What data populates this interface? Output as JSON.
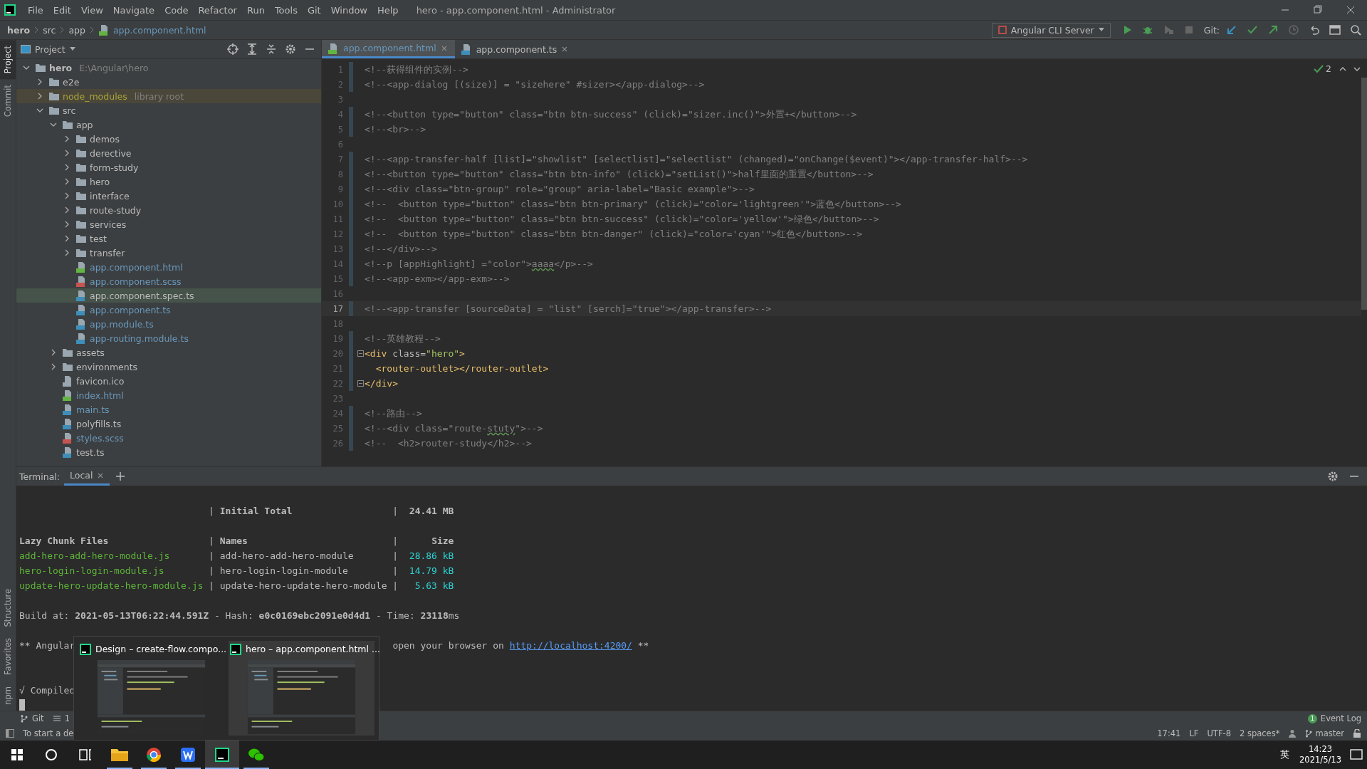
{
  "window": {
    "title": "hero - app.component.html - Administrator"
  },
  "menu": [
    "File",
    "Edit",
    "View",
    "Navigate",
    "Code",
    "Refactor",
    "Run",
    "Tools",
    "Git",
    "Window",
    "Help"
  ],
  "breadcrumbs": [
    "hero",
    "src",
    "app",
    "app.component.html"
  ],
  "toolbar": {
    "run_config": "Angular CLI Server",
    "git_label": "Git:"
  },
  "side_tabs_top": [
    {
      "label": "Project",
      "selected": true
    },
    {
      "label": "Commit",
      "selected": false
    }
  ],
  "side_tabs_bottom": [
    {
      "label": "Structure",
      "selected": false
    },
    {
      "label": "Favorites",
      "selected": false
    },
    {
      "label": "npm",
      "selected": false
    }
  ],
  "project": {
    "title": "Project",
    "tree": [
      {
        "name": "hero",
        "kind": "folder",
        "expanded": true,
        "color": "#bbbbbb",
        "excluded": false,
        "note": "E:\\Angular\\hero",
        "selected": false,
        "children": [
          {
            "name": "e2e",
            "kind": "folder",
            "expanded": false,
            "color": "#bbbbbb",
            "excluded": false,
            "selected": false
          },
          {
            "name": "node_modules",
            "kind": "folder",
            "expanded": false,
            "color": "#a8a23a",
            "excluded": true,
            "note": "library root",
            "selected": false
          },
          {
            "name": "src",
            "kind": "folder",
            "expanded": true,
            "color": "#bbbbbb",
            "excluded": false,
            "selected": false,
            "children": [
              {
                "name": "app",
                "kind": "folder",
                "expanded": true,
                "color": "#bbbbbb",
                "excluded": false,
                "selected": false,
                "children": [
                  {
                    "name": "demos",
                    "kind": "folder",
                    "expanded": false,
                    "color": "#bbbbbb",
                    "excluded": false,
                    "selected": false
                  },
                  {
                    "name": "derective",
                    "kind": "folder",
                    "expanded": false,
                    "color": "#bbbbbb",
                    "excluded": false,
                    "selected": false
                  },
                  {
                    "name": "form-study",
                    "kind": "folder",
                    "expanded": false,
                    "color": "#bbbbbb",
                    "excluded": false,
                    "selected": false
                  },
                  {
                    "name": "hero",
                    "kind": "folder",
                    "expanded": false,
                    "color": "#bbbbbb",
                    "excluded": false,
                    "selected": false
                  },
                  {
                    "name": "interface",
                    "kind": "folder",
                    "expanded": false,
                    "color": "#bbbbbb",
                    "excluded": false,
                    "selected": false
                  },
                  {
                    "name": "route-study",
                    "kind": "folder",
                    "expanded": false,
                    "color": "#bbbbbb",
                    "excluded": false,
                    "selected": false
                  },
                  {
                    "name": "services",
                    "kind": "folder",
                    "expanded": false,
                    "color": "#bbbbbb",
                    "excluded": false,
                    "selected": false
                  },
                  {
                    "name": "test",
                    "kind": "folder",
                    "expanded": false,
                    "color": "#bbbbbb",
                    "excluded": false,
                    "selected": false
                  },
                  {
                    "name": "transfer",
                    "kind": "folder",
                    "expanded": false,
                    "color": "#bbbbbb",
                    "excluded": false,
                    "selected": false
                  },
                  {
                    "name": "app.component.html",
                    "kind": "html",
                    "color": "#6897bb",
                    "excluded": false,
                    "selected": false
                  },
                  {
                    "name": "app.component.scss",
                    "kind": "scss",
                    "color": "#6897bb",
                    "excluded": false,
                    "selected": false
                  },
                  {
                    "name": "app.component.spec.ts",
                    "kind": "ts",
                    "color": "#bbbbbb",
                    "excluded": false,
                    "selected": true
                  },
                  {
                    "name": "app.component.ts",
                    "kind": "ts",
                    "color": "#6897bb",
                    "excluded": false,
                    "selected": false
                  },
                  {
                    "name": "app.module.ts",
                    "kind": "ts",
                    "color": "#6897bb",
                    "excluded": false,
                    "selected": false
                  },
                  {
                    "name": "app-routing.module.ts",
                    "kind": "ts",
                    "color": "#6897bb",
                    "excluded": false,
                    "selected": false
                  }
                ]
              },
              {
                "name": "assets",
                "kind": "folder",
                "expanded": false,
                "color": "#bbbbbb",
                "excluded": false,
                "selected": false
              },
              {
                "name": "environments",
                "kind": "folder",
                "expanded": false,
                "color": "#bbbbbb",
                "excluded": false,
                "selected": false
              },
              {
                "name": "favicon.ico",
                "color": "#bbbbbb",
                "excluded": false,
                "selected": false
              },
              {
                "name": "index.html",
                "kind": "html",
                "color": "#6897bb",
                "excluded": false,
                "selected": false
              },
              {
                "name": "main.ts",
                "kind": "ts",
                "color": "#6897bb",
                "excluded": false,
                "selected": false
              },
              {
                "name": "polyfills.ts",
                "kind": "ts",
                "color": "#bbbbbb",
                "excluded": false,
                "selected": false
              },
              {
                "name": "styles.scss",
                "kind": "scss",
                "color": "#6897bb",
                "excluded": false,
                "selected": false
              },
              {
                "name": "test.ts",
                "kind": "ts",
                "color": "#bbbbbb",
                "excluded": false,
                "selected": false
              }
            ]
          }
        ]
      }
    ]
  },
  "editor": {
    "tabs": [
      {
        "label": "app.component.html",
        "kind": "html",
        "selected": true
      },
      {
        "label": "app.component.ts",
        "kind": "ts",
        "selected": false
      }
    ],
    "problems": "2",
    "lines": [
      {
        "number": "1",
        "changed": true,
        "current": false,
        "fold": false,
        "segments": [
          {
            "text": "<!--获得组件的实例-->",
            "kind": "comment"
          }
        ]
      },
      {
        "number": "2",
        "changed": true,
        "current": false,
        "fold": false,
        "segments": [
          {
            "text": "<!--<app-dialog [(size)] = \"sizehere\" #sizer></app-dialog>-->",
            "kind": "comment"
          }
        ]
      },
      {
        "number": "3",
        "changed": false,
        "current": false,
        "fold": false
      },
      {
        "number": "4",
        "changed": true,
        "current": false,
        "fold": false,
        "segments": [
          {
            "text": "<!--<button type=\"button\" class=\"btn btn-success\" (click)=\"sizer.inc()\">外置+</button>-->",
            "kind": "comment"
          }
        ]
      },
      {
        "number": "5",
        "changed": true,
        "current": false,
        "fold": false,
        "segments": [
          {
            "text": "<!--<br>-->",
            "kind": "comment"
          }
        ]
      },
      {
        "number": "6",
        "changed": false,
        "current": false,
        "fold": false
      },
      {
        "number": "7",
        "changed": true,
        "current": false,
        "fold": false,
        "segments": [
          {
            "text": "<!--<app-transfer-half [list]=\"showlist\" [selectlist]=\"selectlist\" (changed)=\"onChange($event)\"></app-transfer-half>-->",
            "kind": "comment"
          }
        ]
      },
      {
        "number": "8",
        "changed": true,
        "current": false,
        "fold": false,
        "segments": [
          {
            "text": "<!--<button type=\"button\" class=\"btn btn-info\" (click)=\"setList()\">half里面的重置</button>-->",
            "kind": "comment"
          }
        ]
      },
      {
        "number": "9",
        "changed": true,
        "current": false,
        "fold": false,
        "segments": [
          {
            "text": "<!--<div class=\"btn-group\" role=\"group\" aria-label=\"Basic example\">-->",
            "kind": "comment"
          }
        ]
      },
      {
        "number": "10",
        "changed": true,
        "current": false,
        "fold": false,
        "segments": [
          {
            "text": "<!--  <button type=\"button\" class=\"btn btn-primary\" (click)=\"color='lightgreen'\">蓝色</button>-->",
            "kind": "comment"
          }
        ]
      },
      {
        "number": "11",
        "changed": true,
        "current": false,
        "fold": false,
        "segments": [
          {
            "text": "<!--  <button type=\"button\" class=\"btn btn-success\" (click)=\"color='yellow'\">绿色</button>-->",
            "kind": "comment"
          }
        ]
      },
      {
        "number": "12",
        "changed": true,
        "current": false,
        "fold": false,
        "segments": [
          {
            "text": "<!--  <button type=\"button\" class=\"btn btn-danger\" (click)=\"color='cyan'\">红色</button>-->",
            "kind": "comment"
          }
        ]
      },
      {
        "number": "13",
        "changed": true,
        "current": false,
        "fold": false,
        "segments": [
          {
            "text": "<!--</div>-->",
            "kind": "comment"
          }
        ]
      },
      {
        "number": "14",
        "changed": true,
        "current": false,
        "fold": false,
        "segments": [
          {
            "text": "<!--p [appHighlight] =\"color\">",
            "kind": "comment"
          },
          {
            "text": "aaaa",
            "kind": "typo"
          },
          {
            "text": "</p>-->",
            "kind": "comment"
          }
        ]
      },
      {
        "number": "15",
        "changed": true,
        "current": false,
        "fold": false,
        "segments": [
          {
            "text": "<!--<app-exm></app-exm>-->",
            "kind": "comment"
          }
        ]
      },
      {
        "number": "16",
        "changed": false,
        "current": false,
        "fold": false
      },
      {
        "number": "17",
        "changed": true,
        "current": true,
        "fold": false,
        "segments": [
          {
            "text": "<!--<app-transfer [sourceData] = \"list\" [serch]=\"true\"></app-transfer>-->",
            "kind": "comment"
          }
        ]
      },
      {
        "number": "18",
        "changed": false,
        "current": false,
        "fold": false
      },
      {
        "number": "19",
        "changed": true,
        "current": false,
        "fold": false,
        "segments": [
          {
            "text": "<!--英雄教程-->",
            "kind": "comment"
          }
        ]
      },
      {
        "number": "20",
        "changed": true,
        "current": false,
        "fold": true,
        "segments": [
          {
            "text": "<div",
            "kind": "tag"
          },
          {
            "text": " class=",
            "kind": "attr"
          },
          {
            "text": "\"hero\"",
            "kind": "value"
          },
          {
            "text": ">",
            "kind": "tag"
          }
        ]
      },
      {
        "number": "21",
        "changed": true,
        "current": false,
        "fold": false,
        "indented": true,
        "segments": [
          {
            "text": "<router-outlet></router-outlet>",
            "kind": "tag"
          }
        ]
      },
      {
        "number": "22",
        "changed": true,
        "current": false,
        "fold": true,
        "segments": [
          {
            "text": "</div>",
            "kind": "tag"
          }
        ]
      },
      {
        "number": "23",
        "changed": false,
        "current": false,
        "fold": false
      },
      {
        "number": "24",
        "changed": true,
        "current": false,
        "fold": false,
        "segments": [
          {
            "text": "<!--路由-->",
            "kind": "comment"
          }
        ]
      },
      {
        "number": "25",
        "changed": true,
        "current": false,
        "fold": false,
        "segments": [
          {
            "text": "<!--<div class=\"route-",
            "kind": "comment"
          },
          {
            "text": "stuty",
            "kind": "typo"
          },
          {
            "text": "\">-->",
            "kind": "comment"
          }
        ]
      },
      {
        "number": "26",
        "changed": true,
        "current": false,
        "fold": false,
        "segments": [
          {
            "text": "<!--  <h2>router-study</h2>-->",
            "kind": "comment"
          }
        ]
      }
    ]
  },
  "terminal": {
    "label": "Terminal:",
    "tabs": [
      {
        "label": "Local",
        "selected": true
      }
    ],
    "lines": [
      {
        "kind": "blank"
      },
      {
        "kind": "total",
        "cells": [
          "|",
          "Initial Total",
          "|",
          "24.41 MB"
        ]
      },
      {
        "kind": "blank"
      },
      {
        "kind": "header",
        "cells": [
          "Lazy Chunk Files",
          "|",
          "Names",
          "|",
          "Size"
        ]
      },
      {
        "kind": "file",
        "cells": [
          "add-hero-add-hero-module.js",
          "|",
          "add-hero-add-hero-module",
          "|",
          "28.86 kB"
        ]
      },
      {
        "kind": "file",
        "cells": [
          "hero-login-login-module.js",
          "|",
          "hero-login-login-module",
          "|",
          "14.79 kB"
        ]
      },
      {
        "kind": "file",
        "cells": [
          "update-hero-update-hero-module.js",
          "|",
          "update-hero-update-hero-module",
          "|",
          "5.63 kB"
        ]
      },
      {
        "kind": "blank"
      },
      {
        "kind": "text",
        "segments": [
          {
            "text": "Build at: ",
            "kind": "plain"
          },
          {
            "text": "2021-05-13T06:22:44.591Z",
            "kind": "bold"
          },
          {
            "text": " - Hash: ",
            "kind": "plain"
          },
          {
            "text": "e0c0169ebc2091e0d4d1",
            "kind": "bold"
          },
          {
            "text": " - Time: ",
            "kind": "plain"
          },
          {
            "text": "23118",
            "kind": "bold"
          },
          {
            "text": "ms",
            "kind": "plain"
          }
        ]
      },
      {
        "kind": "blank"
      },
      {
        "kind": "covered",
        "before": "** Angular",
        "after": [
          {
            "text": "open your browser on ",
            "kind": "plain"
          },
          {
            "text": "http://localhost:4200/",
            "kind": "link"
          },
          {
            "text": " **",
            "kind": "plain"
          }
        ]
      },
      {
        "kind": "blank"
      },
      {
        "kind": "blank"
      },
      {
        "kind": "text",
        "segments": [
          {
            "text": "√ Compiled",
            "kind": "plain"
          }
        ]
      },
      {
        "kind": "cursor"
      }
    ]
  },
  "tool_bar": [
    {
      "label": "Git",
      "kind": "git"
    },
    {
      "label": "1",
      "kind": "list"
    }
  ],
  "event_log": {
    "label": "Event Log",
    "count": "1"
  },
  "status_bar": {
    "message": "To start a de",
    "items": [
      "17:41",
      "LF",
      "UTF-8",
      "2 spaces*"
    ],
    "branch": "master"
  },
  "task_previews": [
    {
      "title": "Design – create-flow.compo...",
      "selected": false
    },
    {
      "title": "hero – app.component.html ...",
      "selected": true
    }
  ],
  "taskbar": {
    "apps": [
      {
        "kind": "explorer",
        "active": false
      },
      {
        "kind": "browser",
        "active": false
      },
      {
        "kind": "writer",
        "active": false
      },
      {
        "kind": "ide",
        "active": true
      },
      {
        "kind": "chat",
        "active": false
      }
    ],
    "ime": "英",
    "time": "14:23",
    "date": "2021/5/13"
  }
}
